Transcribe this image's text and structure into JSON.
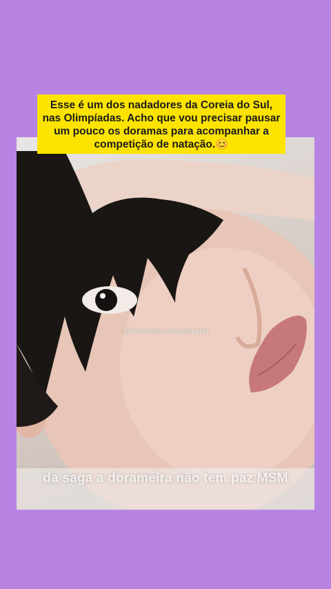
{
  "post": {
    "top_caption": "Esse é um dos nadadores da Coreia do Sul, nas Olimpíadas. Acho que vou precisar pausar um pouco os doramas para acompanhar a competição de natação.😊",
    "watermark": "@dorameiras.emocionadas",
    "subtitle": "da saga a dorameira não tem paz MSM"
  },
  "colors": {
    "background": "#b884e4",
    "caption_bg": "#fde400"
  }
}
